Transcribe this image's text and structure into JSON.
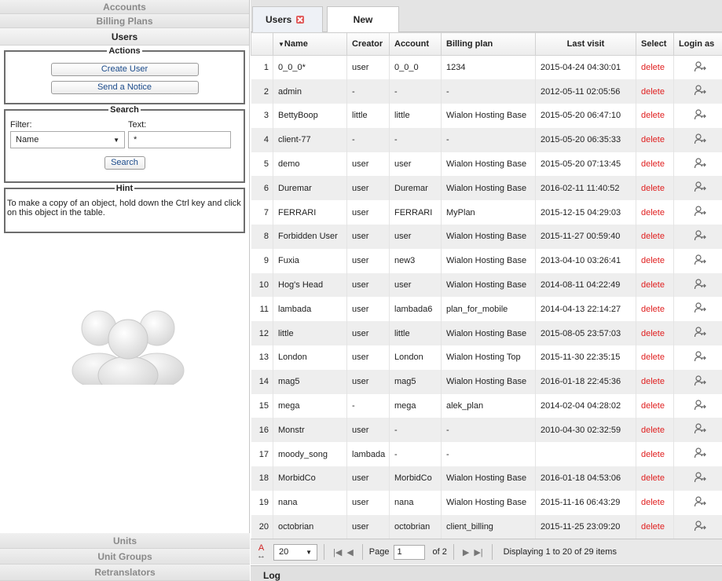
{
  "sidebar": {
    "top_items": [
      "Accounts",
      "Billing Plans",
      "Users"
    ],
    "actions": {
      "legend": "Actions",
      "create_user": "Create User",
      "send_notice": "Send a Notice"
    },
    "search": {
      "legend": "Search",
      "filter_label": "Filter:",
      "text_label": "Text:",
      "filter_value": "Name",
      "text_value": "*",
      "button": "Search"
    },
    "hint": {
      "legend": "Hint",
      "text": "To make a copy of an object, hold down the Ctrl key and click on this object in the table."
    },
    "bottom_items": [
      "Units",
      "Unit Groups",
      "Retranslators"
    ]
  },
  "tabs": [
    {
      "label": "Users",
      "closable": true
    },
    {
      "label": "New"
    }
  ],
  "table": {
    "columns": [
      "",
      "Name",
      "Creator",
      "Account",
      "Billing plan",
      "Last visit",
      "Select",
      "Login as"
    ],
    "rows": [
      [
        "1",
        "0_0_0*",
        "user",
        "0_0_0",
        "1234",
        "2015-04-24 04:30:01",
        "delete"
      ],
      [
        "2",
        "admin",
        "-",
        "-",
        "-",
        "2012-05-11 02:05:56",
        "delete"
      ],
      [
        "3",
        "BettyBoop",
        "little",
        "little",
        "Wialon Hosting Base",
        "2015-05-20 06:47:10",
        "delete"
      ],
      [
        "4",
        "client-77",
        "-",
        "-",
        "-",
        "2015-05-20 06:35:33",
        "delete"
      ],
      [
        "5",
        "demo",
        "user",
        "user",
        "Wialon Hosting Base",
        "2015-05-20 07:13:45",
        "delete"
      ],
      [
        "6",
        "Duremar",
        "user",
        "Duremar",
        "Wialon Hosting Base",
        "2016-02-11 11:40:52",
        "delete"
      ],
      [
        "7",
        "FERRARI",
        "user",
        "FERRARI",
        "MyPlan",
        "2015-12-15 04:29:03",
        "delete"
      ],
      [
        "8",
        "Forbidden User",
        "user",
        "user",
        "Wialon Hosting Base",
        "2015-11-27 00:59:40",
        "delete"
      ],
      [
        "9",
        "Fuxia",
        "user",
        "new3",
        "Wialon Hosting Base",
        "2013-04-10 03:26:41",
        "delete"
      ],
      [
        "10",
        "Hog's Head",
        "user",
        "user",
        "Wialon Hosting Base",
        "2014-08-11 04:22:49",
        "delete"
      ],
      [
        "11",
        "lambada",
        "user",
        "lambada6",
        "plan_for_mobile",
        "2014-04-13 22:14:27",
        "delete"
      ],
      [
        "12",
        "little",
        "user",
        "little",
        "Wialon Hosting Base",
        "2015-08-05 23:57:03",
        "delete"
      ],
      [
        "13",
        "London",
        "user",
        "London",
        "Wialon Hosting Top",
        "2015-11-30 22:35:15",
        "delete"
      ],
      [
        "14",
        "mag5",
        "user",
        "mag5",
        "Wialon Hosting Base",
        "2016-01-18 22:45:36",
        "delete"
      ],
      [
        "15",
        "mega",
        "-",
        "mega",
        "alek_plan",
        "2014-02-04 04:28:02",
        "delete"
      ],
      [
        "16",
        "Monstr",
        "user",
        "-",
        "-",
        "2010-04-30 02:32:59",
        "delete"
      ],
      [
        "17",
        "moody_song",
        "lambada",
        "-",
        "-",
        "",
        "delete"
      ],
      [
        "18",
        "MorbidCo",
        "user",
        "MorbidCo",
        "Wialon Hosting Base",
        "2016-01-18 04:53:06",
        "delete"
      ],
      [
        "19",
        "nana",
        "user",
        "nana",
        "Wialon Hosting Base",
        "2015-11-16 06:43:29",
        "delete"
      ],
      [
        "20",
        "octobrian",
        "user",
        "octobrian",
        "client_billing",
        "2015-11-25 23:09:20",
        "delete"
      ]
    ]
  },
  "pager": {
    "page_size": "20",
    "page_label": "Page",
    "page_value": "1",
    "of_label": "of 2",
    "display_text": "Displaying 1 to 20 of 29 items"
  },
  "log_label": "Log"
}
